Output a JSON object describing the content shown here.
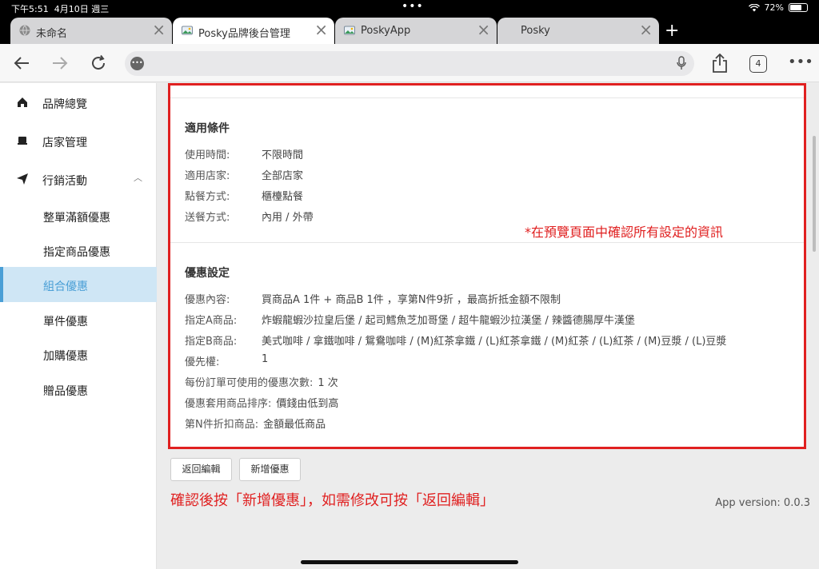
{
  "status": {
    "time": "下午5:51",
    "date": "4月10日 週三",
    "battery": "72%",
    "battery_level": 0.72
  },
  "browser": {
    "tabs": [
      {
        "label": "未命名",
        "active": false
      },
      {
        "label": "Posky品牌後台管理",
        "active": true
      },
      {
        "label": "PoskyApp",
        "active": false
      },
      {
        "label": "Posky",
        "active": false
      }
    ],
    "tab_count": "4"
  },
  "sidebar": {
    "items": [
      {
        "label": "品牌總覽",
        "icon": "home-icon"
      },
      {
        "label": "店家管理",
        "icon": "store-icon"
      },
      {
        "label": "行銷活動",
        "icon": "send-icon",
        "expanded": true
      }
    ],
    "sub_items": [
      {
        "label": "整單滿額優惠"
      },
      {
        "label": "指定商品優惠"
      },
      {
        "label": "組合優惠",
        "active": true
      },
      {
        "label": "單件優惠"
      },
      {
        "label": "加購優惠"
      },
      {
        "label": "贈品優惠"
      }
    ]
  },
  "conditions": {
    "title": "適用條件",
    "rows": [
      {
        "key": "使用時間:",
        "value": "不限時間"
      },
      {
        "key": "適用店家:",
        "value": "全部店家"
      },
      {
        "key": "點餐方式:",
        "value": "櫃檯點餐"
      },
      {
        "key": "送餐方式:",
        "value": "內用 / 外帶"
      }
    ]
  },
  "preview_note": "*在預覽頁面中確認所有設定的資訊",
  "discount": {
    "title": "優惠設定",
    "rows": [
      {
        "key": "優惠內容:",
        "value": "買商品A 1件 + 商品B 1件 ，享第N件9折 ，最高折抵金額不限制"
      },
      {
        "key": "指定A商品:",
        "value": "炸蝦龍蝦沙拉皇后堡 / 起司鱈魚芝加哥堡 / 超牛龍蝦沙拉漢堡 / 辣醬德腸厚牛漢堡"
      },
      {
        "key": "指定B商品:",
        "value": "美式咖啡 / 拿鐵咖啡 / 鴛鴦咖啡 / (M)紅茶拿鐵 / (L)紅茶拿鐵 / (M)紅茶 / (L)紅茶 / (M)豆漿 / (L)豆漿"
      },
      {
        "key": "優先權:",
        "value": "1"
      },
      {
        "key": "每份訂單可使用的優惠次數:",
        "value": "1 次"
      },
      {
        "key": "優惠套用商品排序:",
        "value": "價錢由低到高"
      },
      {
        "key": "第N件折扣商品:",
        "value": "金額最低商品"
      }
    ]
  },
  "buttons": {
    "back": "返回編輯",
    "add": "新增優惠"
  },
  "confirm_note": "確認後按「新增優惠」，如需修改可按「返回編輯」",
  "version": "App version: 0.0.3"
}
